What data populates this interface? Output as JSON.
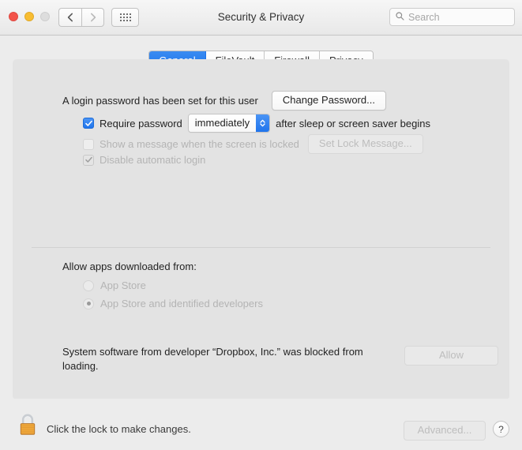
{
  "window": {
    "title": "Security & Privacy",
    "traffic_lights": [
      {
        "name": "close",
        "color": "#f3534a"
      },
      {
        "name": "minimize",
        "color": "#f8bd31"
      },
      {
        "name": "zoom",
        "color": "#dddddd"
      }
    ],
    "nav": {
      "back_icon": "chevron-left-icon",
      "forward_icon": "chevron-right-icon",
      "grid_icon": "show-all-grid-icon"
    }
  },
  "search": {
    "placeholder": "Search",
    "value": "",
    "icon": "search-icon"
  },
  "tabs": [
    {
      "label": "General",
      "active": true
    },
    {
      "label": "FileVault",
      "active": false
    },
    {
      "label": "Firewall",
      "active": false
    },
    {
      "label": "Privacy",
      "active": false
    }
  ],
  "general": {
    "password_status": "A login password has been set for this user",
    "change_password_button": "Change Password...",
    "require_password": {
      "label": "Require password",
      "checked": true,
      "interval": "immediately",
      "suffix": "after sleep or screen saver begins",
      "chevron_icon": "chevron-up-down-icon"
    },
    "lock_message": {
      "label": "Show a message when the screen is locked",
      "checked": false,
      "button": "Set Lock Message...",
      "disabled": true
    },
    "disable_auto_login": {
      "label": "Disable automatic login",
      "checked": true,
      "disabled": true
    },
    "allow_apps": {
      "title": "Allow apps downloaded from:",
      "options": [
        {
          "label": "App Store",
          "selected": false
        },
        {
          "label": "App Store and identified developers",
          "selected": true
        }
      ],
      "disabled": true
    },
    "blocked_software": {
      "message": "System software from developer “Dropbox, Inc.” was blocked from loading.",
      "allow_button": "Allow",
      "allow_disabled": true
    }
  },
  "bottom_bar": {
    "lock_icon": "lock-closed-icon",
    "lock_text": "Click the lock to make changes.",
    "advanced_button": "Advanced...",
    "advanced_disabled": true,
    "help_button": "?"
  },
  "colors": {
    "accent_blue": "#1f74ec",
    "window_bg": "#ececec",
    "panel_bg": "#e3e3e3",
    "lock_body": "#f0a93c",
    "disabled_text": "#b4b4b4"
  }
}
